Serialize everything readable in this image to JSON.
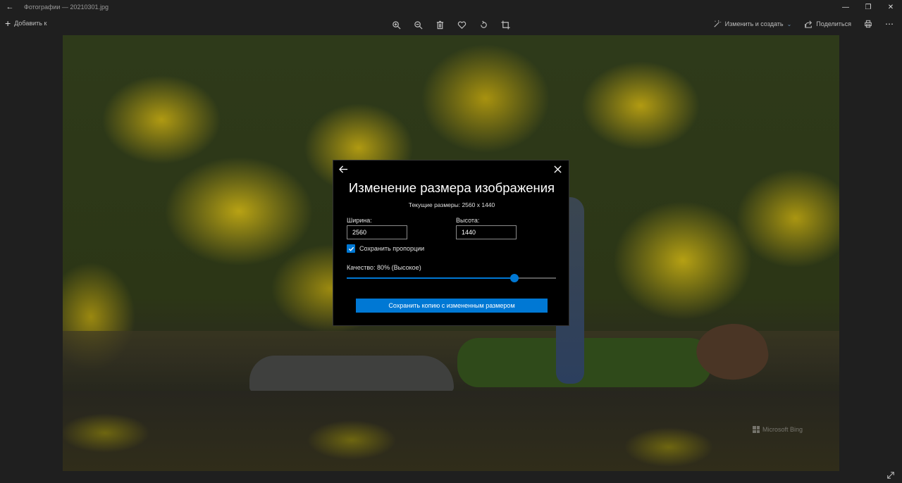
{
  "window": {
    "title": "Фотографии — 20210301.jpg",
    "controls": {
      "minimize": "—",
      "restore": "❐",
      "close": "✕"
    }
  },
  "toolbar": {
    "add_label": "Добавить к",
    "edit_label": "Изменить и создать",
    "share_label": "Поделиться",
    "more_label": "⋯",
    "tools": [
      "zoom-in",
      "zoom-out",
      "delete",
      "favorite",
      "rotate",
      "crop"
    ]
  },
  "photo": {
    "watermark": "Microsoft Bing"
  },
  "dialog": {
    "title": "Изменение размера изображения",
    "current_size": "Текущие размеры: 2560 x 1440",
    "width_label": "Ширина:",
    "width_value": "2560",
    "height_label": "Высота:",
    "height_value": "1440",
    "keep_ratio_label": "Сохранить пропорции",
    "keep_ratio_checked": true,
    "quality_label": "Качество: 80% (Высокое)",
    "quality_fraction": 0.8,
    "save_label": "Сохранить копию с измененным размером"
  },
  "colors": {
    "accent": "#0078d4",
    "background": "#1f1f1f",
    "dialog_bg": "#000000"
  }
}
